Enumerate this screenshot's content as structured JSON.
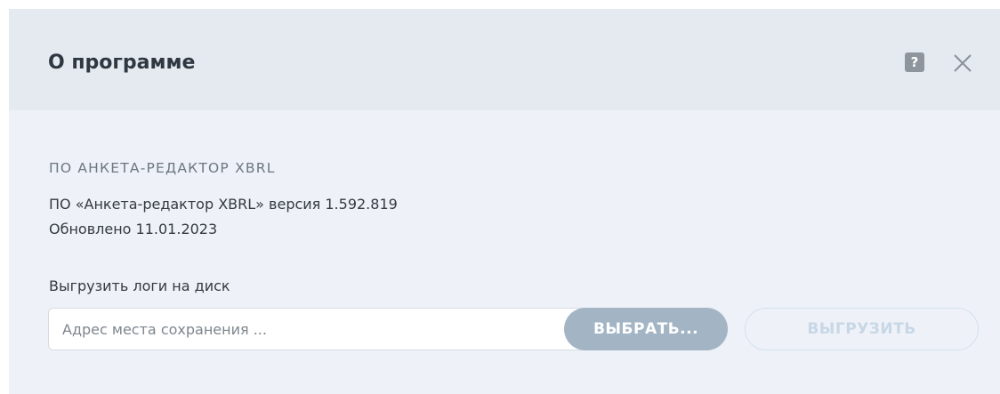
{
  "dialog": {
    "title": "О программе",
    "help_icon_glyph": "?",
    "icons": {
      "help": "help-icon",
      "close": "close-icon"
    }
  },
  "about": {
    "section_title": "ПО АНКЕТА-РЕДАКТОР XBRL",
    "version_text": "ПО «Анкета-редактор XBRL» версия 1.592.819",
    "updated_text": "Обновлено 11.01.2023"
  },
  "logs": {
    "label": "Выгрузить логи на диск",
    "path_input": {
      "value": "",
      "placeholder": "Адрес места сохранения ..."
    },
    "choose_label": "ВЫБРАТЬ...",
    "upload_label": "ВЫГРУЗИТЬ"
  },
  "colors": {
    "header_bg": "#e5eaf1",
    "content_bg": "#eef2f8",
    "choose_button_bg": "#a3b5c5",
    "upload_button_text": "#c8d7e6"
  }
}
